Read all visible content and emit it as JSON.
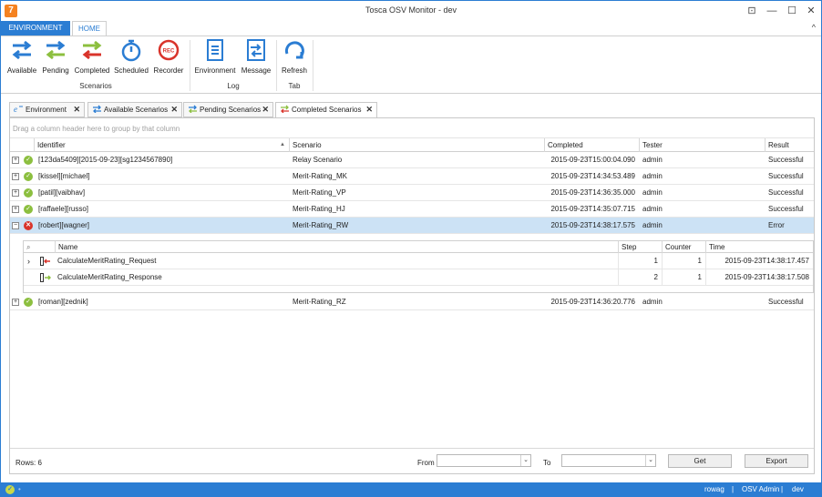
{
  "window": {
    "app_icon": "7",
    "title": "Tosca OSV Monitor - dev",
    "controls": {
      "restore": "⊡",
      "minimize": "—",
      "maximize": "☐",
      "close": "✕"
    }
  },
  "ribbon": {
    "tabs": {
      "environment": "ENVIRONMENT",
      "home": "HOME"
    },
    "collapse": "^",
    "buttons": {
      "available": "Available",
      "pending": "Pending",
      "completed": "Completed",
      "scheduled": "Scheduled",
      "recorder": "Recorder",
      "environment": "Environment",
      "message": "Message",
      "refresh": "Refresh"
    },
    "groups": {
      "scenarios": "Scenarios",
      "log": "Log",
      "tab": "Tab"
    },
    "rec_text": "REC"
  },
  "doc_tabs": [
    {
      "label": "Environment",
      "close": "✕"
    },
    {
      "label": "Available Scenarios",
      "close": "✕"
    },
    {
      "label": "Pending Scenarios",
      "close": "✕"
    },
    {
      "label": "Completed Scenarios",
      "close": "✕"
    }
  ],
  "grid": {
    "group_hint": "Drag a column header here to group by that column",
    "columns": {
      "identifier": "Identifier",
      "scenario": "Scenario",
      "completed": "Completed",
      "tester": "Tester",
      "result": "Result"
    },
    "sort_indicator": "▲",
    "rows": [
      {
        "expander": "+",
        "identifier": "[123da5409][2015-09-23][sg1234567890]",
        "scenario": "Relay Scenario",
        "completed": "2015-09-23T15:00:04.090",
        "tester": "admin",
        "result": "Successful"
      },
      {
        "expander": "+",
        "identifier": "[kissel][michael]",
        "scenario": "Merit-Rating_MK",
        "completed": "2015-09-23T14:34:53.489",
        "tester": "admin",
        "result": "Successful"
      },
      {
        "expander": "+",
        "identifier": "[patil][vaibhav]",
        "scenario": "Merit-Rating_VP",
        "completed": "2015-09-23T14:36:35.000",
        "tester": "admin",
        "result": "Successful"
      },
      {
        "expander": "+",
        "identifier": "[raffaele][russo]",
        "scenario": "Merit-Rating_HJ",
        "completed": "2015-09-23T14:35:07.715",
        "tester": "admin",
        "result": "Successful"
      },
      {
        "expander": "−",
        "identifier": "[robert][wagner]",
        "scenario": "Merit-Rating_RW",
        "completed": "2015-09-23T14:38:17.575",
        "tester": "admin",
        "result": "Error"
      },
      {
        "expander": "+",
        "identifier": "[roman][zednik]",
        "scenario": "Merit-Rating_RZ",
        "completed": "2015-09-23T14:36:20.776",
        "tester": "admin",
        "result": "Successful"
      }
    ],
    "status_marks": {
      "ok": "✓",
      "error": "✕"
    }
  },
  "detail": {
    "search_icon": "⌕",
    "columns": {
      "name": "Name",
      "step": "Step",
      "counter": "Counter",
      "time": "Time"
    },
    "row_pointer": "›",
    "rows": [
      {
        "name": "CalculateMeritRating_Request",
        "step": "1",
        "counter": "1",
        "time": "2015-09-23T14:38:17.457"
      },
      {
        "name": "CalculateMeritRating_Response",
        "step": "2",
        "counter": "1",
        "time": "2015-09-23T14:38:17.508"
      }
    ]
  },
  "footer": {
    "rows_label": "Rows: 6",
    "from_label": "From",
    "to_label": "To",
    "dropdown_arrow": "⌄",
    "get_button": "Get",
    "export_button": "Export"
  },
  "statusbar": {
    "ok_mark": "✓",
    "items": [
      "rowag",
      "OSV Admin",
      "dev"
    ],
    "separator": "|",
    "dot": "•"
  },
  "colors": {
    "accent": "#2b7dd3",
    "success": "#8cbf3f",
    "error": "#d9342b",
    "selected_row": "#cce2f5",
    "app_icon": "#f58220"
  }
}
